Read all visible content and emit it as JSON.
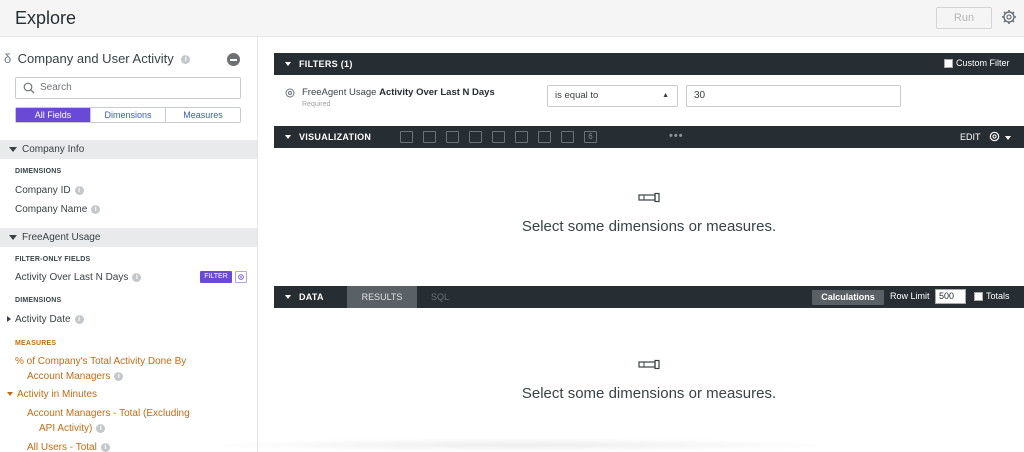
{
  "header": {
    "title": "Explore",
    "run_label": "Run",
    "settings_icon": "gear-icon"
  },
  "sidebar": {
    "model_title": "Company and User Activity",
    "search_placeholder": "Search",
    "segments": [
      "All Fields",
      "Dimensions",
      "Measures"
    ],
    "groups": {
      "company_info": {
        "label": "Company Info",
        "dimensions_label": "DIMENSIONS",
        "fields": [
          "Company ID",
          "Company Name"
        ]
      },
      "freeagent_usage": {
        "label": "FreeAgent Usage",
        "filter_only_label": "FILTER-ONLY FIELDS",
        "filter_only_field": "Activity Over Last N Days",
        "filter_badge": "FILTER",
        "dimensions_label": "DIMENSIONS",
        "dimension_field": "Activity Date",
        "measures_label": "MEASURES",
        "measure_1_line1": "% of Company's Total Activity Done By",
        "measure_1_line2": "Account Managers",
        "measure_group": "Activity in Minutes",
        "measure_2_line1": "Account Managers - Total (Excluding",
        "measure_2_line2": "API Activity)",
        "measure_3": "All Users - Total"
      }
    }
  },
  "filters": {
    "bar_label": "FILTERS (1)",
    "custom_filter_label": "Custom Filter",
    "field_prefix": "FreeAgent Usage",
    "field_name": "Activity Over Last N Days",
    "required_label": "Required",
    "operator": "is equal to",
    "value": "30"
  },
  "visualization": {
    "bar_label": "VISUALIZATION",
    "edit_label": "EDIT",
    "single_value_icon_text": "6",
    "empty_message": "Select some dimensions or measures."
  },
  "data": {
    "bar_label": "DATA",
    "tab_results": "RESULTS",
    "tab_sql": "SQL",
    "calculations_label": "Calculations",
    "row_limit_label": "Row Limit",
    "row_limit_value": "500",
    "totals_label": "Totals",
    "empty_message": "Select some dimensions or measures."
  },
  "colors": {
    "accent": "#6a49d6",
    "bar_dark": "#262d33",
    "measure_orange": "#c36b14"
  }
}
